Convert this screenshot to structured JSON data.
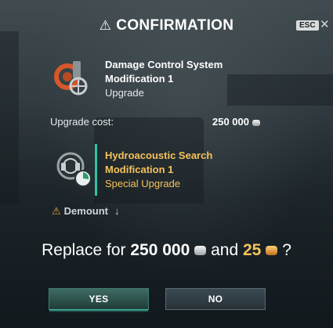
{
  "dialog": {
    "title": "CONFIRMATION",
    "warning_icon": "warning-triangle-icon",
    "esc_label": "ESC",
    "close_icon": "close-icon"
  },
  "current_item": {
    "name_line1": "Damage Control System",
    "name_line2": "Modification 1",
    "type": "Upgrade",
    "icon": "damage-control-icon"
  },
  "upgrade_cost": {
    "label": "Upgrade cost:",
    "value": "250 000",
    "currency_icon": "silver-coin-icon"
  },
  "new_item": {
    "name_line1": "Hydroacoustic Search",
    "name_line2": "Modification 1",
    "type": "Special Upgrade",
    "icon": "hydroacoustic-search-icon"
  },
  "demount": {
    "label": "Demount",
    "warn_icon": "warning-triangle-icon",
    "arrow_icon": "arrow-down-icon"
  },
  "question": {
    "prefix": "Replace for",
    "silver_amount": "250 000",
    "conjunction": "and",
    "gold_amount": "25",
    "suffix": "?"
  },
  "buttons": {
    "yes": "YES",
    "no": "NO"
  },
  "colors": {
    "accent_gold": "#f5c35a",
    "accent_teal": "#2ec4a8",
    "warning": "#e6a23c"
  }
}
